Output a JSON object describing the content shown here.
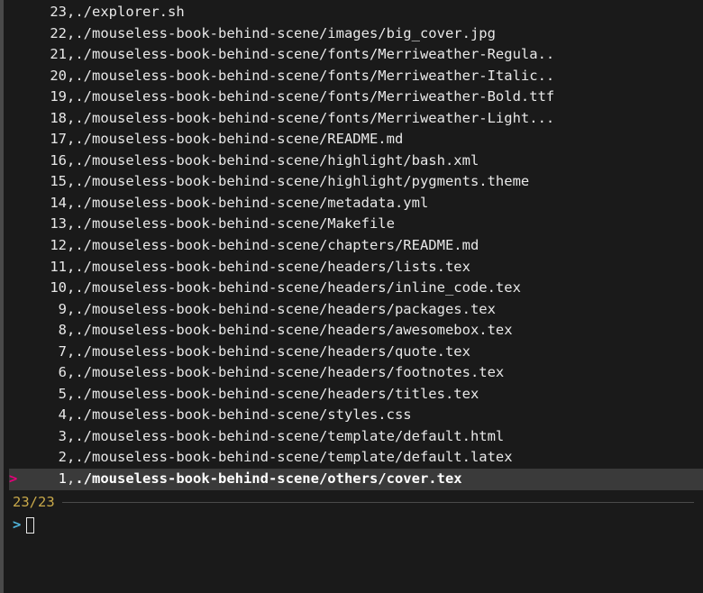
{
  "entries": [
    {
      "num": "23",
      "path": "./explorer.sh",
      "selected": false
    },
    {
      "num": "22",
      "path": "./mouseless-book-behind-scene/images/big_cover.jpg",
      "selected": false
    },
    {
      "num": "21",
      "path": "./mouseless-book-behind-scene/fonts/Merriweather-Regula..",
      "selected": false
    },
    {
      "num": "20",
      "path": "./mouseless-book-behind-scene/fonts/Merriweather-Italic..",
      "selected": false
    },
    {
      "num": "19",
      "path": "./mouseless-book-behind-scene/fonts/Merriweather-Bold.ttf",
      "selected": false
    },
    {
      "num": "18",
      "path": "./mouseless-book-behind-scene/fonts/Merriweather-Light...",
      "selected": false
    },
    {
      "num": "17",
      "path": "./mouseless-book-behind-scene/README.md",
      "selected": false
    },
    {
      "num": "16",
      "path": "./mouseless-book-behind-scene/highlight/bash.xml",
      "selected": false
    },
    {
      "num": "15",
      "path": "./mouseless-book-behind-scene/highlight/pygments.theme",
      "selected": false
    },
    {
      "num": "14",
      "path": "./mouseless-book-behind-scene/metadata.yml",
      "selected": false
    },
    {
      "num": "13",
      "path": "./mouseless-book-behind-scene/Makefile",
      "selected": false
    },
    {
      "num": "12",
      "path": "./mouseless-book-behind-scene/chapters/README.md",
      "selected": false
    },
    {
      "num": "11",
      "path": "./mouseless-book-behind-scene/headers/lists.tex",
      "selected": false
    },
    {
      "num": "10",
      "path": "./mouseless-book-behind-scene/headers/inline_code.tex",
      "selected": false
    },
    {
      "num": "9",
      "path": "./mouseless-book-behind-scene/headers/packages.tex",
      "selected": false
    },
    {
      "num": "8",
      "path": "./mouseless-book-behind-scene/headers/awesomebox.tex",
      "selected": false
    },
    {
      "num": "7",
      "path": "./mouseless-book-behind-scene/headers/quote.tex",
      "selected": false
    },
    {
      "num": "6",
      "path": "./mouseless-book-behind-scene/headers/footnotes.tex",
      "selected": false
    },
    {
      "num": "5",
      "path": "./mouseless-book-behind-scene/headers/titles.tex",
      "selected": false
    },
    {
      "num": "4",
      "path": "./mouseless-book-behind-scene/styles.css",
      "selected": false
    },
    {
      "num": "3",
      "path": "./mouseless-book-behind-scene/template/default.html",
      "selected": false
    },
    {
      "num": "2",
      "path": "./mouseless-book-behind-scene/template/default.latex",
      "selected": false
    },
    {
      "num": "1",
      "path": "./mouseless-book-behind-scene/others/cover.tex",
      "selected": true
    }
  ],
  "pointer": ">",
  "separator": ",",
  "status": {
    "count": "23/23"
  },
  "prompt": {
    "char": ">",
    "value": ""
  }
}
